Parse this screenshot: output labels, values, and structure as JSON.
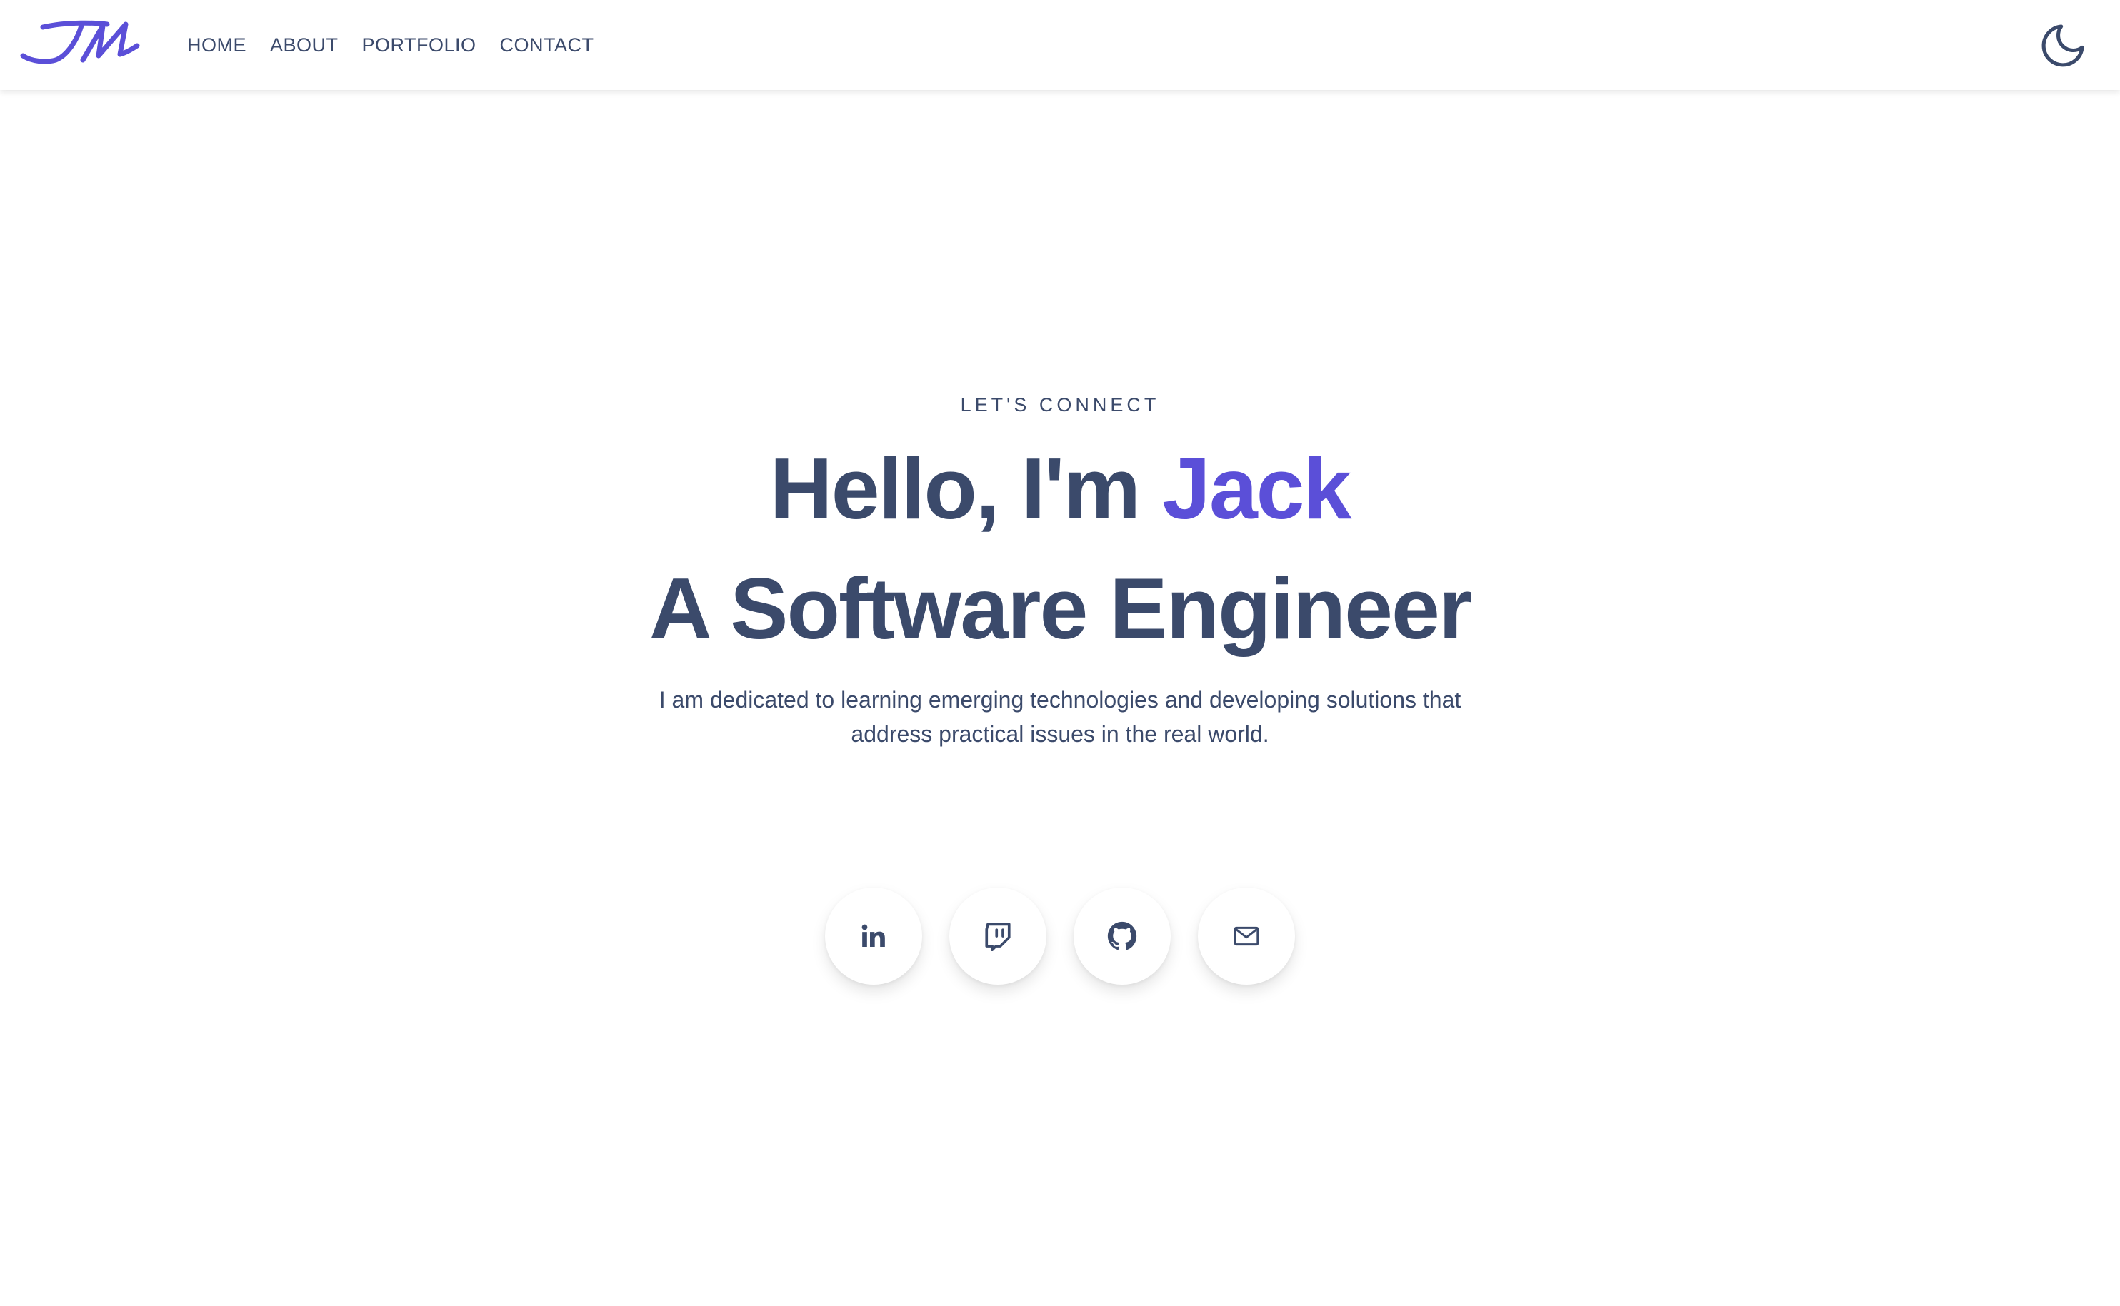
{
  "brand": {
    "logo_text": "JM",
    "accent_color": "#5b4fd8",
    "text_color": "#3b4a6b"
  },
  "nav": {
    "items": [
      {
        "label": "HOME"
      },
      {
        "label": "ABOUT"
      },
      {
        "label": "PORTFOLIO"
      },
      {
        "label": "CONTACT"
      }
    ],
    "theme_toggle_icon": "moon-icon"
  },
  "hero": {
    "eyebrow": "LET'S CONNECT",
    "greeting": "Hello, I'm ",
    "name": "Jack",
    "role": "A Software Engineer",
    "description": "I am dedicated to learning emerging technologies and developing solutions that address practical issues in the real world."
  },
  "socials": [
    {
      "icon": "linkedin-icon"
    },
    {
      "icon": "twitch-icon"
    },
    {
      "icon": "github-icon"
    },
    {
      "icon": "mail-icon"
    }
  ]
}
